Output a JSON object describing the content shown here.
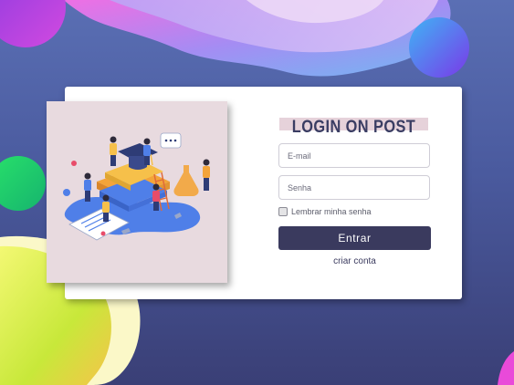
{
  "login": {
    "title": "LOGIN ON POST",
    "email_placeholder": "E-mail",
    "password_placeholder": "Senha",
    "remember_label": "Lembrar minha senha",
    "submit_label": "Entrar",
    "create_account_label": "criar conta"
  },
  "colors": {
    "accent": "#3a3a5e",
    "title_highlight": "#e6d2da",
    "illustration_bg": "#e8dadf",
    "background_top": "#5a6fb4",
    "background_bottom": "#3a3f76"
  },
  "icons": {
    "illustration": "education-isometric-illustration"
  }
}
